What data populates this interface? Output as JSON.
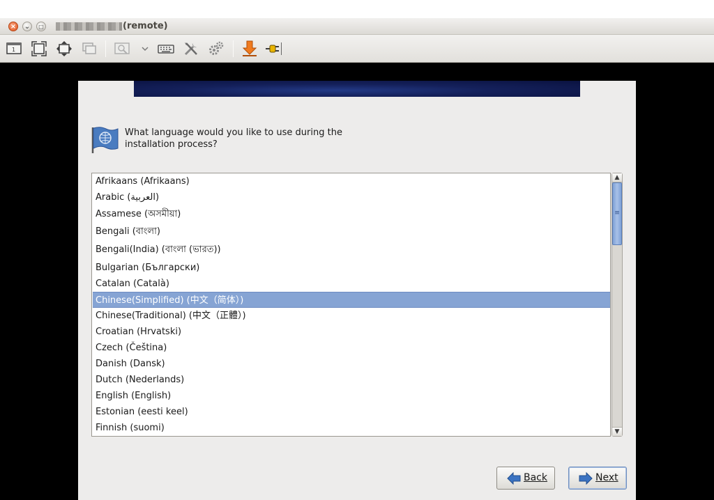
{
  "window": {
    "title_suffix": "(remote)",
    "buttons": {
      "close": "×",
      "minimize": "⌄",
      "maximize": "□"
    }
  },
  "toolbar": {
    "icons": [
      "screen-icon",
      "fullscreen-icon",
      "fit-window-icon",
      "scaled-icon",
      "zoom-icon",
      "dropdown-chevron-icon",
      "keyboard-icon",
      "preferences-icon",
      "gears-icon",
      "download-icon",
      "disconnect-icon"
    ]
  },
  "installer": {
    "question_line1": "What language would you like to use during the",
    "question_line2": "installation process?",
    "languages": [
      "Afrikaans (Afrikaans)",
      "Arabic (العربية)",
      "Assamese (অসমীয়া)",
      "Bengali (বাংলা)",
      "Bengali(India) (বাংলা (ভারত))",
      "Bulgarian (Български)",
      "Catalan (Català)",
      "Chinese(Simplified) (中文（简体）)",
      "Chinese(Traditional) (中文（正體）)",
      "Croatian (Hrvatski)",
      "Czech (Čeština)",
      "Danish (Dansk)",
      "Dutch (Nederlands)",
      "English (English)",
      "Estonian (eesti keel)",
      "Finnish (suomi)"
    ],
    "selected_language": "Chinese(Simplified) (中文（简体）)",
    "back_label": "Back",
    "next_label": "Next"
  },
  "colors": {
    "selection": "#86a4d4",
    "banner": "#14205a",
    "installer_bg": "#edeceb"
  }
}
